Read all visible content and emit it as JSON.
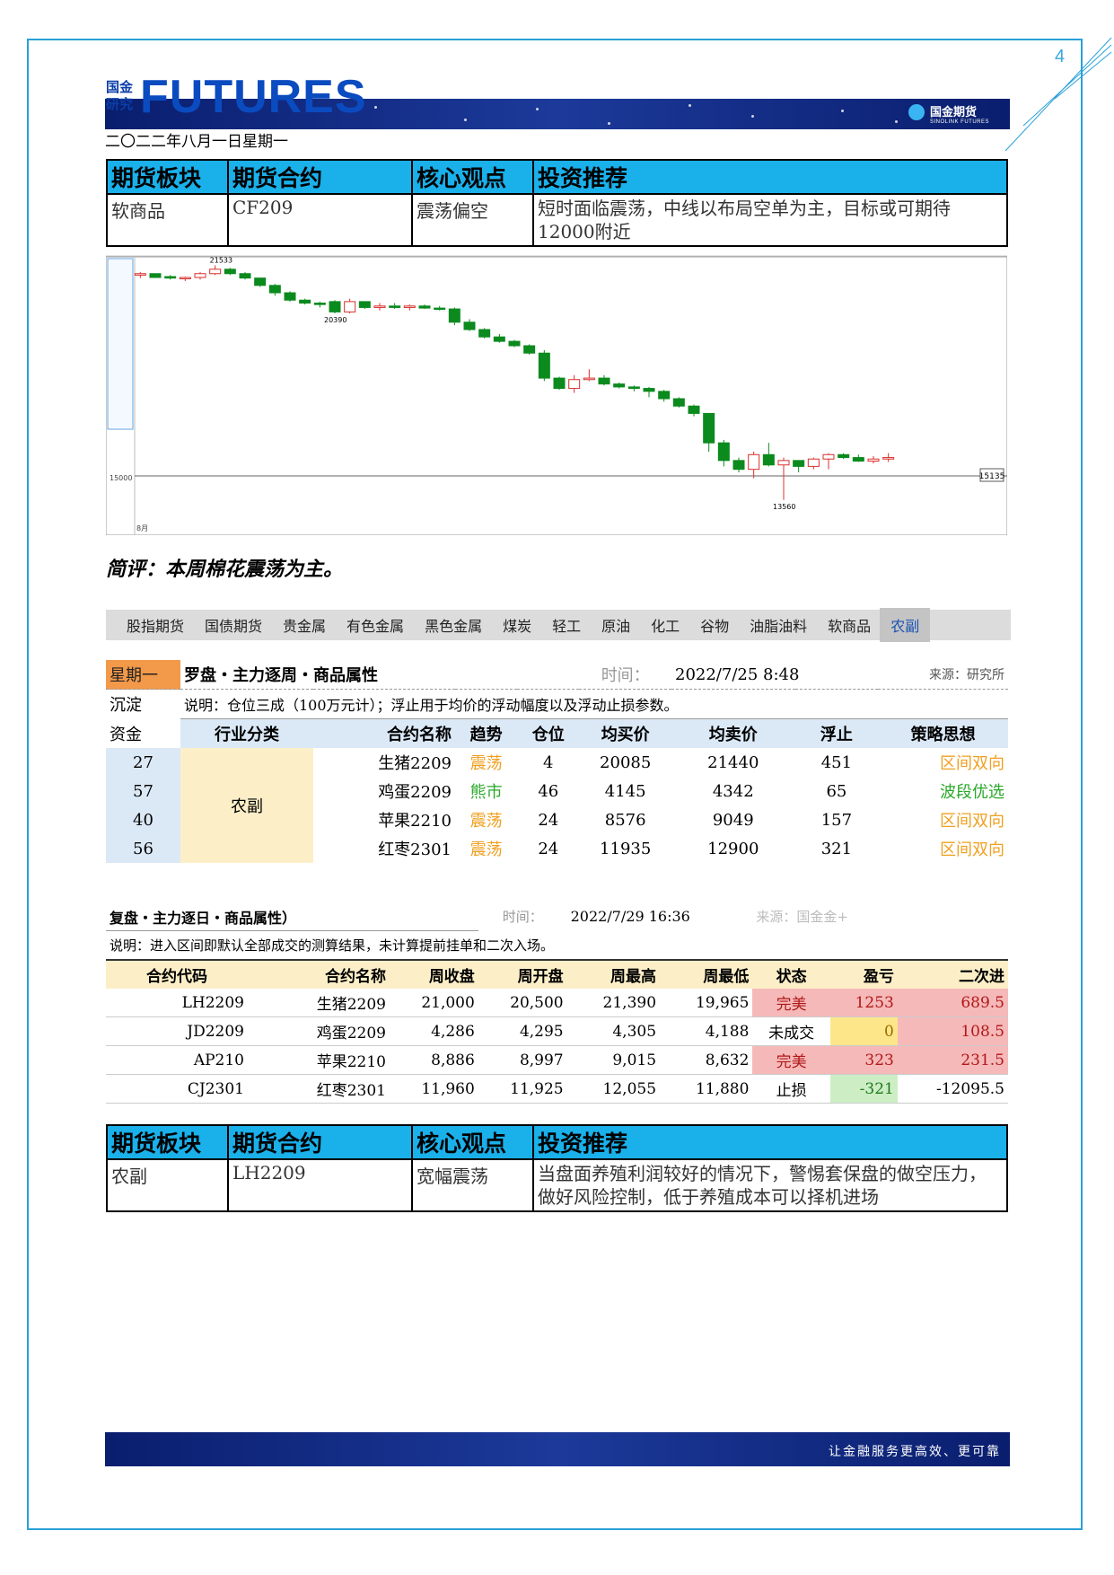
{
  "page_number": "4",
  "logo": {
    "cn_top": "国金",
    "cn_bottom": "研究",
    "en": "FUTURES"
  },
  "brand": {
    "name": "国金期货",
    "sub": "SINOLINK FUTURES"
  },
  "date": "二〇二二年八月一日星期一",
  "rec_headers": [
    "期货板块",
    "期货合约",
    "核心观点",
    "投资推荐"
  ],
  "rec1": {
    "sector": "软商品",
    "contract": "CF209",
    "view": "震荡偏空",
    "advice": "短时面临震荡，中线以布局空单为主，目标或可期待12000附近"
  },
  "remark": "简评：本周棉花震荡为主。",
  "chart_data": {
    "type": "candlestick",
    "annotations": [
      "21533",
      "20390",
      "13560"
    ],
    "right_label": "15135",
    "left_tick": "15000",
    "bottom_label": "8月",
    "candles": [
      [
        21200,
        21300,
        21100,
        21250
      ],
      [
        21250,
        21250,
        21100,
        21120
      ],
      [
        21150,
        21200,
        21050,
        21100
      ],
      [
        21100,
        21150,
        21000,
        21120
      ],
      [
        21120,
        21300,
        21050,
        21250
      ],
      [
        21250,
        21533,
        21200,
        21400
      ],
      [
        21400,
        21450,
        21200,
        21250
      ],
      [
        21250,
        21300,
        21050,
        21100
      ],
      [
        21100,
        21100,
        20800,
        20850
      ],
      [
        20850,
        20900,
        20500,
        20600
      ],
      [
        20600,
        20650,
        20300,
        20350
      ],
      [
        20350,
        20400,
        20200,
        20250
      ],
      [
        20250,
        20300,
        20100,
        20200
      ],
      [
        20300,
        20350,
        19900,
        19950
      ],
      [
        19950,
        20400,
        19900,
        20300
      ],
      [
        20300,
        20300,
        20050,
        20100
      ],
      [
        20100,
        20250,
        20000,
        20150
      ],
      [
        20150,
        20250,
        20050,
        20100
      ],
      [
        20100,
        20200,
        20000,
        20150
      ],
      [
        20150,
        20200,
        20050,
        20080
      ],
      [
        20080,
        20150,
        20000,
        20050
      ],
      [
        20050,
        20100,
        19500,
        19600
      ],
      [
        19600,
        19700,
        19300,
        19350
      ],
      [
        19350,
        19400,
        19050,
        19100
      ],
      [
        19100,
        19200,
        18900,
        18950
      ],
      [
        18950,
        19000,
        18750,
        18800
      ],
      [
        18800,
        18850,
        18500,
        18550
      ],
      [
        18550,
        18650,
        17600,
        17700
      ],
      [
        17700,
        17750,
        17300,
        17350
      ],
      [
        17350,
        17800,
        17200,
        17650
      ],
      [
        17650,
        18000,
        17600,
        17700
      ],
      [
        17700,
        17800,
        17450,
        17500
      ],
      [
        17500,
        17550,
        17350,
        17400
      ],
      [
        17400,
        17450,
        17250,
        17350
      ],
      [
        17350,
        17400,
        17050,
        17250
      ],
      [
        17250,
        17300,
        16900,
        17000
      ],
      [
        17000,
        17050,
        16700,
        16750
      ],
      [
        16750,
        16800,
        16400,
        16500
      ],
      [
        16500,
        16500,
        15200,
        15500
      ],
      [
        15500,
        15600,
        14700,
        14900
      ],
      [
        14900,
        15000,
        14500,
        14600
      ],
      [
        14600,
        15200,
        14300,
        15100
      ],
      [
        15100,
        15500,
        14700,
        14750
      ],
      [
        14750,
        15000,
        13560,
        14900
      ],
      [
        14900,
        14900,
        14500,
        14700
      ],
      [
        14700,
        15000,
        14600,
        14950
      ],
      [
        14950,
        15150,
        14600,
        15100
      ],
      [
        15100,
        15150,
        14950,
        15000
      ],
      [
        15000,
        15100,
        14850,
        14880
      ],
      [
        14880,
        15050,
        14800,
        14950
      ],
      [
        14950,
        15150,
        14850,
        15000
      ]
    ]
  },
  "nav": [
    "股指期货",
    "国债期货",
    "贵金属",
    "有色金属",
    "黑色金属",
    "煤炭",
    "轻工",
    "原油",
    "化工",
    "谷物",
    "油脂油料",
    "软商品",
    "农副"
  ],
  "t1": {
    "weekday": "星期一",
    "title": "罗盘・主力逐周・商品属性",
    "time_label": "时间：",
    "time": "2022/7/25 8:48",
    "source": "来源：研究所",
    "side_labels": [
      "沉淀",
      "资金"
    ],
    "note": "说明：仓位三成（100万元计）；浮止用于均价的浮动幅度以及浮动止损参数。",
    "headers": [
      "行业分类",
      "合约名称",
      "趋势",
      "仓位",
      "均买价",
      "均卖价",
      "浮止",
      "策略思想"
    ],
    "industry": "农副",
    "rows": [
      {
        "fund": "27",
        "name": "生猪2209",
        "trend": "震荡",
        "pos": "4",
        "buy": "20085",
        "sell": "21440",
        "stop": "451",
        "strategy": "区间双向"
      },
      {
        "fund": "57",
        "name": "鸡蛋2209",
        "trend": "熊市",
        "pos": "46",
        "buy": "4145",
        "sell": "4342",
        "stop": "65",
        "strategy": "波段优选"
      },
      {
        "fund": "40",
        "name": "苹果2210",
        "trend": "震荡",
        "pos": "24",
        "buy": "8576",
        "sell": "9049",
        "stop": "157",
        "strategy": "区间双向"
      },
      {
        "fund": "56",
        "name": "红枣2301",
        "trend": "震荡",
        "pos": "24",
        "buy": "11935",
        "sell": "12900",
        "stop": "321",
        "strategy": "区间双向"
      }
    ]
  },
  "t2": {
    "title": "复盘・主力逐日・商品属性）",
    "time_label": "时间：",
    "time": "2022/7/29 16:36",
    "source": "来源：国金金+",
    "note": "说明：进入区间即默认全部成交的测算结果，未计算提前挂单和二次入场。",
    "headers": [
      "合约代码",
      "合约名称",
      "周收盘",
      "周开盘",
      "周最高",
      "周最低",
      "状态",
      "盈亏",
      "二次进"
    ],
    "rows": [
      {
        "code": "LH2209",
        "name": "生猪2209",
        "close": "21,000",
        "open": "20,500",
        "high": "21,390",
        "low": "19,965",
        "status": "完美",
        "pnl": "1253",
        "second": "689.5"
      },
      {
        "code": "JD2209",
        "name": "鸡蛋2209",
        "close": "4,286",
        "open": "4,295",
        "high": "4,305",
        "low": "4,188",
        "status": "未成交",
        "pnl": "0",
        "second": "108.5"
      },
      {
        "code": "AP210",
        "name": "苹果2210",
        "close": "8,886",
        "open": "8,997",
        "high": "9,015",
        "low": "8,632",
        "status": "完美",
        "pnl": "323",
        "second": "231.5"
      },
      {
        "code": "CJ2301",
        "name": "红枣2301",
        "close": "11,960",
        "open": "11,925",
        "high": "12,055",
        "low": "11,880",
        "status": "止损",
        "pnl": "-321",
        "second": "-12095.5"
      }
    ]
  },
  "rec2": {
    "sector": "农副",
    "contract": "LH2209",
    "view": "宽幅震荡",
    "advice": "当盘面养殖利润较好的情况下，警惕套保盘的做空压力，做好风险控制，低于养殖成本可以择机进场"
  },
  "footer_slogan": "让金融服务更高效、更可靠",
  "colors": {
    "up": "#d9302c",
    "down": "#0b8a1e",
    "header_blue": "#1ab0ea",
    "orange_text": "#f0a020",
    "green_text": "#2aa82a"
  }
}
